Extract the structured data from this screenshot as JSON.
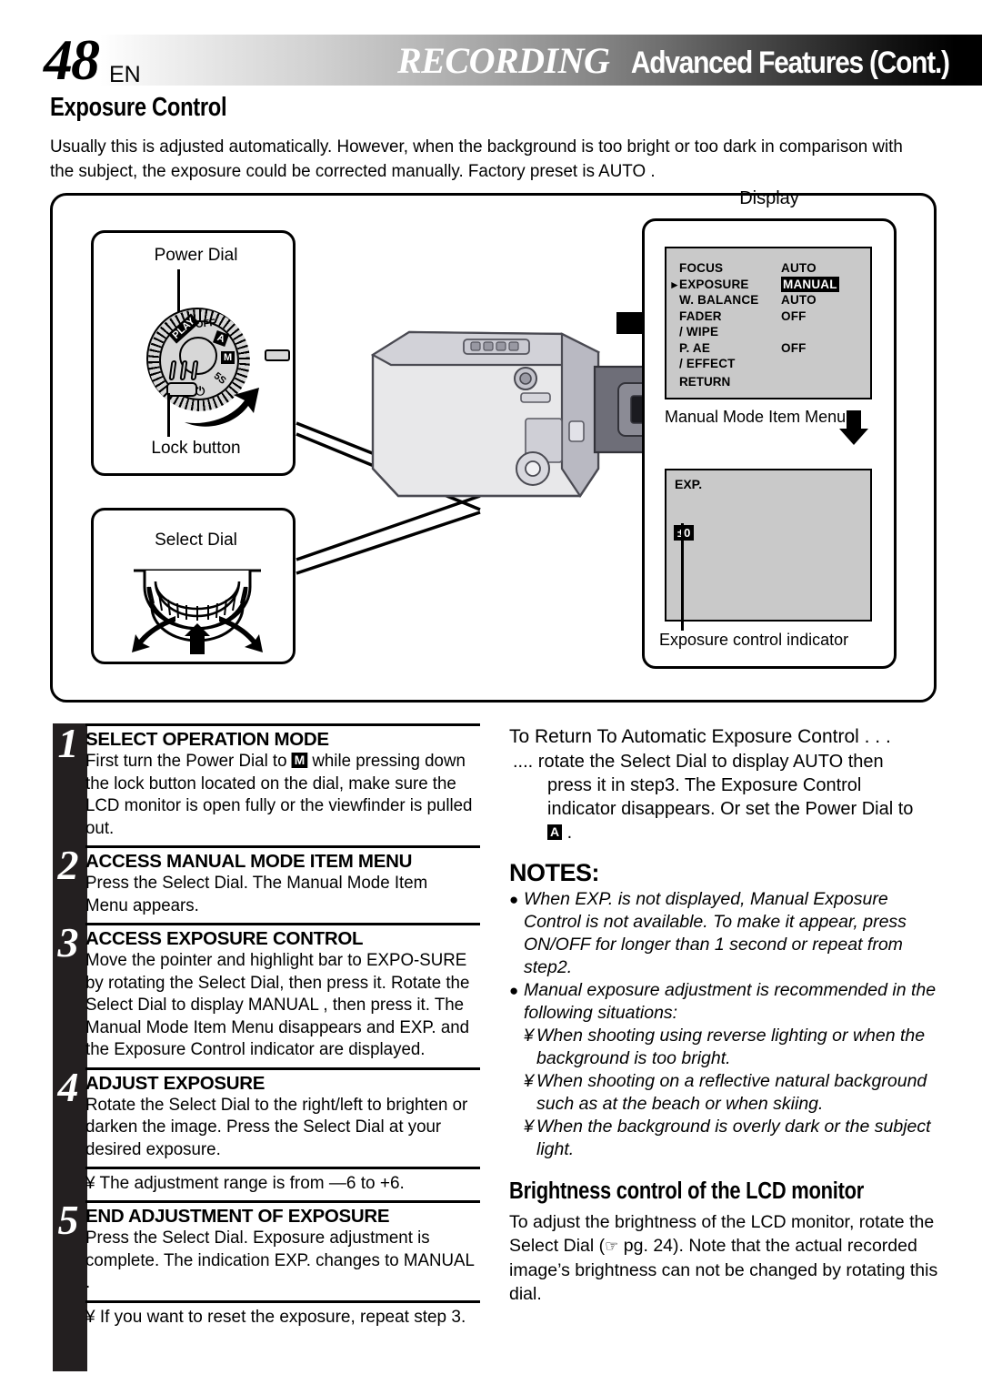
{
  "header": {
    "page_number": "48",
    "page_lang": "EN",
    "title_italic": "RECORDING",
    "title_bold": "Advanced Features (Cont.)"
  },
  "section": {
    "heading": "Exposure Control",
    "intro": "Usually this is adjusted automatically. However, when the background is too bright or too dark in comparison with the subject, the exposure could be corrected manually. Factory preset is  AUTO ."
  },
  "figure": {
    "power_dial": {
      "label": "Power Dial",
      "lock_label": "Lock button",
      "positions": [
        "PLAY",
        "OFF",
        "A",
        "M",
        "5S",
        "⏻"
      ]
    },
    "select_dial": {
      "label": "Select Dial"
    },
    "display": {
      "label": "Display",
      "menu": {
        "rows": [
          {
            "label": "FOCUS",
            "value": "AUTO",
            "pointer": false,
            "highlight": false
          },
          {
            "label": "EXPOSURE",
            "value": "MANUAL",
            "pointer": true,
            "highlight": true
          },
          {
            "label": "W. BALANCE",
            "value": "AUTO",
            "pointer": false,
            "highlight": false
          },
          {
            "label": "FADER",
            "value": "OFF",
            "pointer": false,
            "highlight": false
          },
          {
            "label": "  / WIPE",
            "value": "",
            "pointer": false,
            "highlight": false
          },
          {
            "label": "P. AE",
            "value": "OFF",
            "pointer": false,
            "highlight": false
          },
          {
            "label": "  / EFFECT",
            "value": "",
            "pointer": false,
            "highlight": false
          }
        ],
        "return_label": "RETURN"
      },
      "menu_caption": "Manual Mode Item Menu",
      "exp_screen": {
        "title": "EXP.",
        "indicator_value": "±0"
      },
      "indicator_caption": "Exposure control indicator"
    }
  },
  "steps": [
    {
      "number": "1",
      "title": "SELECT OPERATION MODE",
      "text_before": "First turn the Power Dial to ",
      "chip": "M",
      "text_after": " while pressing down the lock button located on the dial, make sure the LCD monitor is open fully or the viewfinder is pulled out."
    },
    {
      "number": "2",
      "title": "ACCESS MANUAL MODE ITEM MENU",
      "text": "Press the Select Dial. The Manual Mode Item Menu appears."
    },
    {
      "number": "3",
      "title": "ACCESS EXPOSURE CONTROL",
      "text": "Move the pointer and highlight bar to  EXPO-SURE  by rotating the Select Dial, then press it. Rotate the Select Dial to display  MANUAL , then press it. The Manual Mode Item Menu disappears and  EXP.  and the Exposure Control indicator are displayed."
    },
    {
      "number": "4",
      "title": "ADJUST EXPOSURE",
      "text": "Rotate the Select Dial to the right/left to brighten or darken the image. Press the Select Dial at your desired exposure."
    }
  ],
  "step4_note": "¥ The adjustment range is from —6 to +6.",
  "step5": {
    "number": "5",
    "title": "END ADJUSTMENT OF EXPOSURE",
    "text": "Press the Select Dial. Exposure adjustment is complete. The indication  EXP.  changes to  MANUAL ."
  },
  "step5_note": "¥ If you want to reset the exposure, repeat step 3.",
  "right_column": {
    "return_heading": "To Return To Automatic Exposure Control . . .",
    "return_line1": ".... rotate the Select Dial to display  AUTO  then",
    "return_line2": "press it in step3. The Exposure Control",
    "return_line3": "indicator disappears. Or set the Power Dial to",
    "return_chip": "A",
    "return_period": " .",
    "notes_title": "NOTES:",
    "notes": [
      "When  EXP.  is not displayed, Manual Exposure Control is not available. To make it appear, press ON/OFF for longer than 1 second or repeat from step2.",
      "Manual exposure adjustment is recommended in the following situations:"
    ],
    "subnotes": [
      "When shooting using reverse lighting or when the background is too bright.",
      "When shooting on a reflective natural background such as at the beach or when skiing.",
      "When the background is overly dark or the subject light."
    ],
    "brightness_title": "Brightness control of the LCD monitor",
    "brightness_text_1": "To adjust the brightness of the LCD monitor, rotate the Select Dial (",
    "brightness_hand": "☞",
    "brightness_text_2": " pg. 24). Note that the actual recorded image’s brightness can not be changed by rotating this dial."
  },
  "colors": {
    "ink": "#000000",
    "lcd_background": "#c9c9c9",
    "dial_background": "#d7d7d7",
    "step_bar": "#231f20"
  }
}
